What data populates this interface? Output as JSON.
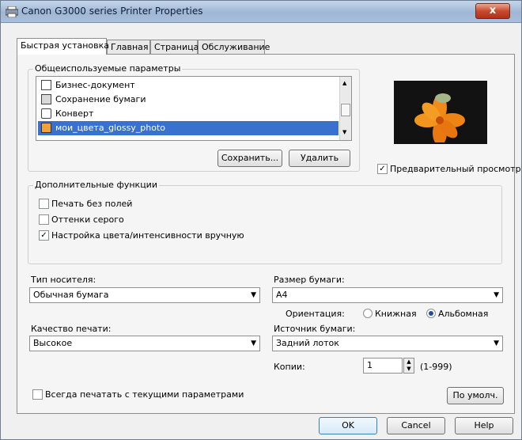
{
  "window": {
    "title": "Canon G3000 series Printer Properties",
    "close_label": "x"
  },
  "tabs": [
    {
      "label": "Быстрая установка"
    },
    {
      "label": "Главная"
    },
    {
      "label": "Страница"
    },
    {
      "label": "Обслуживание"
    }
  ],
  "common_settings": {
    "group_label": "Общеиспользуемые параметры",
    "items": [
      {
        "label": "Бизнес-документ",
        "icon": "document-icon"
      },
      {
        "label": "Сохранение бумаги",
        "icon": "paper-save-icon"
      },
      {
        "label": "Конверт",
        "icon": "envelope-icon"
      },
      {
        "label": "мои_цвета_glossy_photo",
        "icon": "photo-icon",
        "selected": true
      }
    ],
    "save_button": "Сохранить...",
    "delete_button": "Удалить"
  },
  "preview": {
    "checkbox_label": "Предварительный просмотр",
    "checked": true
  },
  "extra_functions": {
    "group_label": "Дополнительные функции",
    "options": [
      {
        "label": "Печать без полей",
        "checked": false
      },
      {
        "label": "Оттенки серого",
        "checked": false
      },
      {
        "label": "Настройка цвета/интенсивности вручную",
        "checked": true
      }
    ]
  },
  "media_type": {
    "label": "Тип носителя:",
    "value": "Обычная бумага"
  },
  "paper_size": {
    "label": "Размер бумаги:",
    "value": "A4"
  },
  "orientation": {
    "label": "Ориентация:",
    "portrait": "Книжная",
    "landscape": "Альбомная",
    "selected": "landscape"
  },
  "print_quality": {
    "label": "Качество печати:",
    "value": "Высокое"
  },
  "paper_source": {
    "label": "Источник бумаги:",
    "value": "Задний лоток"
  },
  "copies": {
    "label": "Копии:",
    "value": "1",
    "range": "(1-999)"
  },
  "always_print": {
    "label": "Всегда печатать с текущими параметрами",
    "checked": false
  },
  "defaults_button": "По умолч.",
  "footer": {
    "ok": "OK",
    "cancel": "Cancel",
    "help": "Help"
  }
}
